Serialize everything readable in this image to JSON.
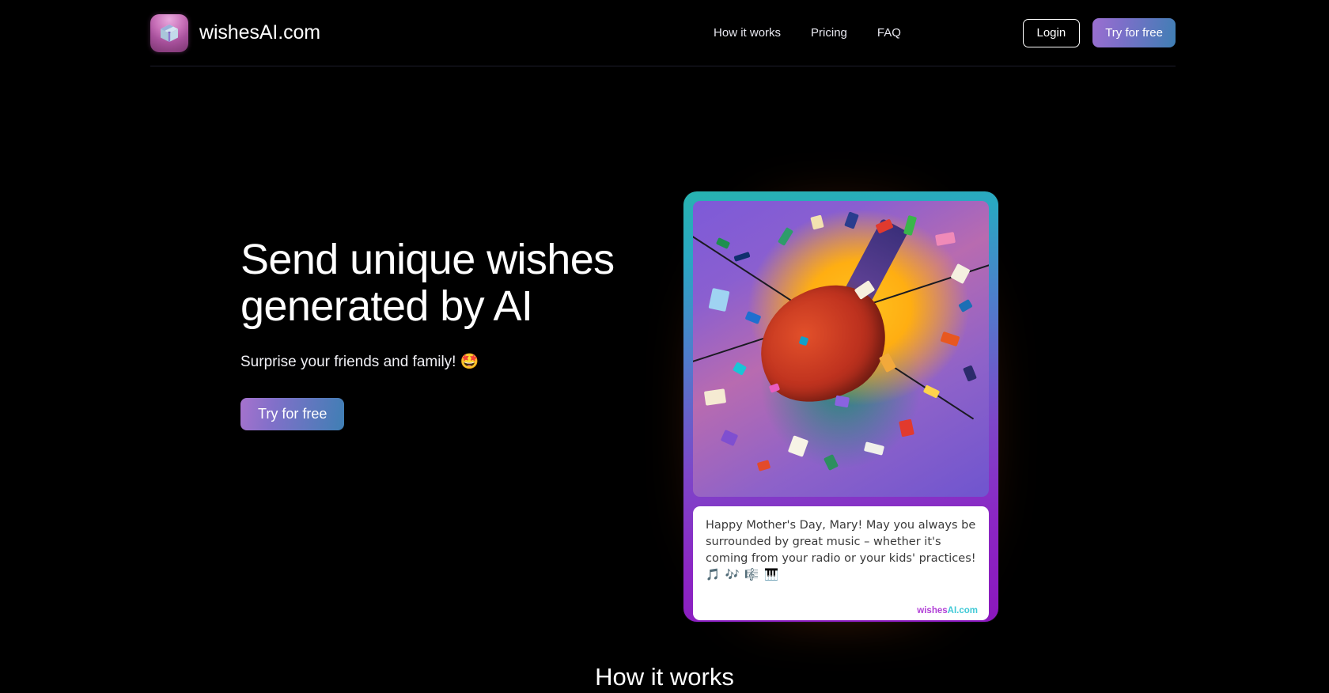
{
  "site": {
    "brand_name": "wishesAI.com",
    "logo_icon": "gift-box-icon"
  },
  "header": {
    "nav": [
      {
        "label": "How it works"
      },
      {
        "label": "Pricing"
      },
      {
        "label": "FAQ"
      }
    ],
    "login_label": "Login",
    "try_label": "Try for free"
  },
  "hero": {
    "title_line1": "Send unique wishes",
    "title_line2": "generated by AI",
    "subtitle": "Surprise your friends and family! 🤩",
    "cta_label": "Try for free"
  },
  "card": {
    "art_alt": "colorful-abstract-violin-confetti-illustration",
    "message_line1": "Happy Mother's Day, Mary! May you always be",
    "message_line2": "surrounded by great music – whether it's coming from",
    "message_line3": "your radio or your kids' practices!",
    "message_emojis": "🎵 🎶 🎼 🎹",
    "watermark_part1": "wishes",
    "watermark_part2": "AI.com"
  },
  "sections": {
    "how_it_works_title": "How it works"
  },
  "colors": {
    "background": "#000000",
    "accent_purple": "#9b6fd0",
    "accent_blue": "#3f7fb4",
    "card_border_top": "#27b3b0",
    "card_border_bottom": "#8b17bd",
    "card_glow": "#ff9628",
    "watermark_purple": "#b13fd6",
    "watermark_cyan": "#3fc9d6"
  }
}
